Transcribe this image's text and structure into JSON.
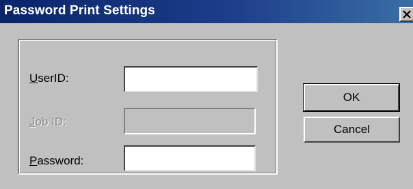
{
  "window": {
    "title": "Password Print Settings"
  },
  "form": {
    "userid": {
      "label_accel": "U",
      "label_rest": "serID:",
      "value": "",
      "enabled": true
    },
    "jobid": {
      "label_accel": "J",
      "label_rest": "ob ID:",
      "value": "",
      "enabled": false
    },
    "password": {
      "label_accel": "P",
      "label_rest": "assword:",
      "value": "",
      "enabled": true
    }
  },
  "buttons": {
    "ok_label": "OK",
    "cancel_label": "Cancel"
  },
  "icons": {
    "close": "close-icon"
  },
  "colors": {
    "titlebar_start": "#0a246a",
    "titlebar_end": "#3a6ea5",
    "dialog_face": "#c0c0c0"
  }
}
